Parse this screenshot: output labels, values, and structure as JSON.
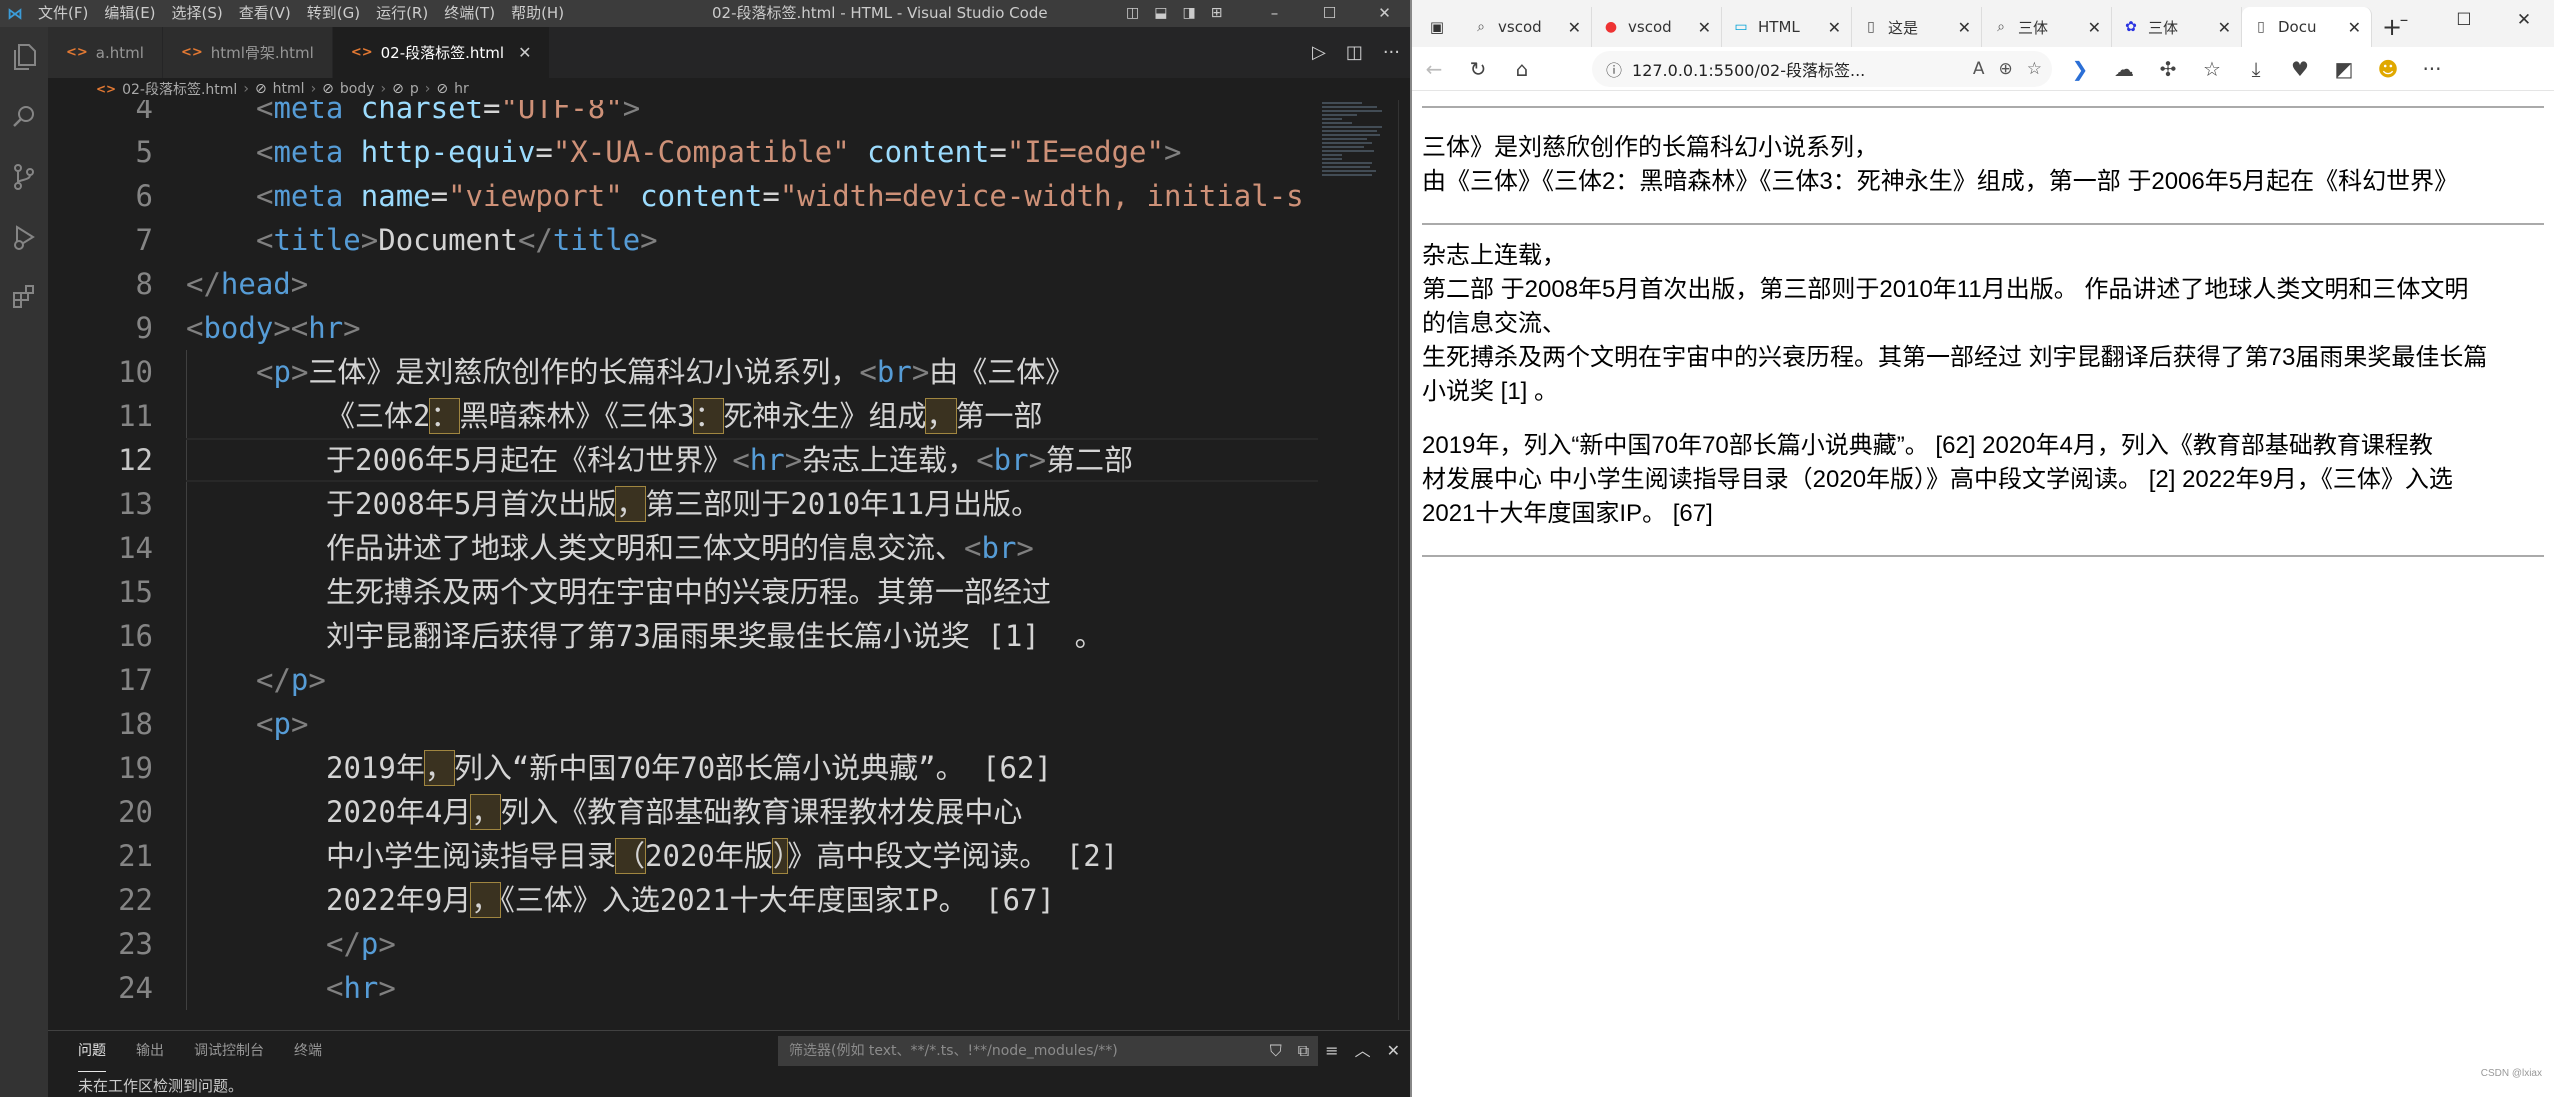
{
  "vscode": {
    "menu": [
      "文件(F)",
      "编辑(E)",
      "选择(S)",
      "查看(V)",
      "转到(G)",
      "运行(R)",
      "终端(T)",
      "帮助(H)"
    ],
    "window_title": "02-段落标签.html - HTML - Visual Studio Code",
    "tabs": [
      {
        "label": "a.html",
        "active": false
      },
      {
        "label": "html骨架.html",
        "active": false
      },
      {
        "label": "02-段落标签.html",
        "active": true
      }
    ],
    "breadcrumb": [
      "02-段落标签.html",
      "html",
      "body",
      "p",
      "hr"
    ],
    "current_line": 12,
    "panel_tabs": [
      "问题",
      "输出",
      "调试控制台",
      "终端"
    ],
    "filter_placeholder": "筛选器(例如 text、**/*.ts、!**/node_modules/**)",
    "panel_message": "未在工作区检测到问题。",
    "icons": [
      "files-icon",
      "search-icon",
      "source-control-icon",
      "run-debug-icon",
      "extensions-icon"
    ]
  },
  "code_lines": [
    {
      "n": "4",
      "indent": 1,
      "tokens": [
        [
          "p",
          "<"
        ],
        [
          "t",
          "meta "
        ],
        [
          "a",
          "charset"
        ],
        [
          "x",
          "="
        ],
        [
          "s",
          "\"UTF-8\""
        ],
        [
          "p",
          ">"
        ]
      ]
    },
    {
      "n": "5",
      "indent": 1,
      "tokens": [
        [
          "p",
          "<"
        ],
        [
          "t",
          "meta "
        ],
        [
          "a",
          "http-equiv"
        ],
        [
          "x",
          "="
        ],
        [
          "s",
          "\"X-UA-Compatible\" "
        ],
        [
          "a",
          "content"
        ],
        [
          "x",
          "="
        ],
        [
          "s",
          "\"IE=edge\""
        ],
        [
          "p",
          ">"
        ]
      ]
    },
    {
      "n": "6",
      "indent": 1,
      "tokens": [
        [
          "p",
          "<"
        ],
        [
          "t",
          "meta "
        ],
        [
          "a",
          "name"
        ],
        [
          "x",
          "="
        ],
        [
          "s",
          "\"viewport\" "
        ],
        [
          "a",
          "content"
        ],
        [
          "x",
          "="
        ],
        [
          "s",
          "\"width=device-width, initial-s"
        ]
      ]
    },
    {
      "n": "7",
      "indent": 1,
      "tokens": [
        [
          "p",
          "<"
        ],
        [
          "t",
          "title"
        ],
        [
          "p",
          ">"
        ],
        [
          "x",
          "Document"
        ],
        [
          "p",
          "</"
        ],
        [
          "t",
          "title"
        ],
        [
          "p",
          ">"
        ]
      ]
    },
    {
      "n": "8",
      "indent": 0,
      "tokens": [
        [
          "p",
          "</"
        ],
        [
          "t",
          "head"
        ],
        [
          "p",
          ">"
        ]
      ]
    },
    {
      "n": "9",
      "indent": 0,
      "tokens": [
        [
          "p",
          "<"
        ],
        [
          "t",
          "body"
        ],
        [
          "p",
          "><"
        ],
        [
          "t",
          "hr"
        ],
        [
          "p",
          ">"
        ]
      ]
    },
    {
      "n": "10",
      "indent": 1,
      "tokens": [
        [
          "p",
          "<"
        ],
        [
          "t",
          "p"
        ],
        [
          "p",
          ">"
        ],
        [
          "x",
          "三体》是刘慈欣创作的长篇科幻小说系列，"
        ],
        [
          "p",
          "<"
        ],
        [
          "t",
          "br"
        ],
        [
          "p",
          ">"
        ],
        [
          "x",
          "由《三体》"
        ]
      ]
    },
    {
      "n": "11",
      "indent": 2,
      "tokens": [
        [
          "x",
          "《三体2"
        ],
        [
          "hl",
          "："
        ],
        [
          "x",
          "黑暗森林》《三体3"
        ],
        [
          "hl",
          "："
        ],
        [
          "x",
          "死神永生》组成"
        ],
        [
          "hl",
          "，"
        ],
        [
          "x",
          "第一部"
        ]
      ]
    },
    {
      "n": "12",
      "indent": 2,
      "tokens": [
        [
          "x",
          "于2006年5月起在《科幻世界》"
        ],
        [
          "p",
          "<"
        ],
        [
          "t",
          "hr"
        ],
        [
          "p",
          ">"
        ],
        [
          "x",
          "杂志上连载，"
        ],
        [
          "p",
          "<"
        ],
        [
          "t",
          "br"
        ],
        [
          "p",
          ">"
        ],
        [
          "x",
          "第二部"
        ]
      ]
    },
    {
      "n": "13",
      "indent": 2,
      "tokens": [
        [
          "x",
          "于2008年5月首次出版"
        ],
        [
          "hl",
          "，"
        ],
        [
          "x",
          "第三部则于2010年11月出版。"
        ]
      ]
    },
    {
      "n": "14",
      "indent": 2,
      "tokens": [
        [
          "x",
          "作品讲述了地球人类文明和三体文明的信息交流、"
        ],
        [
          "p",
          "<"
        ],
        [
          "t",
          "br"
        ],
        [
          "p",
          ">"
        ]
      ]
    },
    {
      "n": "15",
      "indent": 2,
      "tokens": [
        [
          "x",
          "生死搏杀及两个文明在宇宙中的兴衰历程。其第一部经过"
        ]
      ]
    },
    {
      "n": "16",
      "indent": 2,
      "tokens": [
        [
          "x",
          "刘宇昆翻译后获得了第73届雨果奖最佳长篇小说奖 [1]  。"
        ]
      ]
    },
    {
      "n": "17",
      "indent": 1,
      "tokens": [
        [
          "p",
          "</"
        ],
        [
          "t",
          "p"
        ],
        [
          "p",
          ">"
        ]
      ]
    },
    {
      "n": "18",
      "indent": 1,
      "tokens": [
        [
          "p",
          "<"
        ],
        [
          "t",
          "p"
        ],
        [
          "p",
          ">"
        ]
      ]
    },
    {
      "n": "19",
      "indent": 2,
      "tokens": [
        [
          "x",
          "2019年"
        ],
        [
          "hl",
          "，"
        ],
        [
          "x",
          "列入“新中国70年70部长篇小说典藏”。 [62]"
        ]
      ]
    },
    {
      "n": "20",
      "indent": 2,
      "tokens": [
        [
          "x",
          "2020年4月"
        ],
        [
          "hl",
          "，"
        ],
        [
          "x",
          "列入《教育部基础教育课程教材发展中心"
        ]
      ]
    },
    {
      "n": "21",
      "indent": 2,
      "tokens": [
        [
          "x",
          "中小学生阅读指导目录"
        ],
        [
          "hl",
          "（"
        ],
        [
          "x",
          "2020年版"
        ],
        [
          "hl",
          "）"
        ],
        [
          "x",
          "》高中段文学阅读。 [2]"
        ]
      ]
    },
    {
      "n": "22",
      "indent": 2,
      "tokens": [
        [
          "x",
          "2022年9月"
        ],
        [
          "hl",
          "，"
        ],
        [
          "x",
          "《三体》入选2021十大年度国家IP。 [67]"
        ]
      ]
    },
    {
      "n": "23",
      "indent": 2,
      "tokens": [
        [
          "p",
          "</"
        ],
        [
          "t",
          "p"
        ],
        [
          "p",
          ">"
        ]
      ]
    },
    {
      "n": "24",
      "indent": 2,
      "tokens": [
        [
          "p",
          "<"
        ],
        [
          "t",
          "hr"
        ],
        [
          "p",
          ">"
        ]
      ]
    }
  ],
  "browser": {
    "tabs": [
      {
        "label": "vscod",
        "icon": "search-icon"
      },
      {
        "label": "vscod",
        "icon": "csdn-icon"
      },
      {
        "label": "HTML",
        "icon": "bilibili-icon"
      },
      {
        "label": "这是",
        "icon": "page-icon"
      },
      {
        "label": "三体",
        "icon": "search-icon"
      },
      {
        "label": "三体",
        "icon": "baidu-icon"
      },
      {
        "label": "Docu",
        "icon": "page-icon",
        "active": true
      }
    ],
    "url": "127.0.0.1:5500/02-段落标签...",
    "page": {
      "p1": [
        "三体》是刘慈欣创作的长篇科幻小说系列，",
        "由《三体》《三体2：黑暗森林》《三体3：死神永生》组成，第一部 于2006年5月起在《科幻世界》"
      ],
      "p2": [
        "杂志上连载，",
        "第二部 于2008年5月首次出版，第三部则于2010年11月出版。 作品讲述了地球人类文明和三体文明",
        "的信息交流、",
        "生死搏杀及两个文明在宇宙中的兴衰历程。其第一部经过 刘宇昆翻译后获得了第73届雨果奖最佳长篇",
        "小说奖 [1] 。"
      ],
      "p3": [
        "2019年，列入“新中国70年70部长篇小说典藏”。 [62] 2020年4月，列入《教育部基础教育课程教",
        "材发展中心 中小学生阅读指导目录（2020年版）》高中段文学阅读。 [2] 2022年9月，《三体》入选",
        "2021十大年度国家IP。 [67]"
      ]
    },
    "watermark": "CSDN @lxiax"
  }
}
